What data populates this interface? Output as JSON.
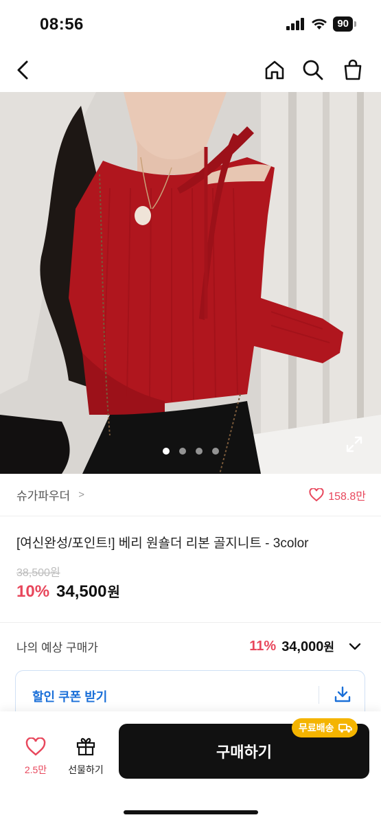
{
  "status_bar": {
    "time": "08:56",
    "battery": "90"
  },
  "nav": {
    "icons": [
      "back-chevron-icon",
      "home-icon",
      "search-icon",
      "shopping-bag-icon"
    ]
  },
  "hero": {
    "slides_total": 4,
    "active_slide": 1,
    "colors": {
      "sweater": "#b0161e",
      "background": "#d9d6d2"
    }
  },
  "brand": {
    "name": "슈가파우더",
    "chevron": ">",
    "likes": "158.8만"
  },
  "product": {
    "title": "[여신완성/포인트!] 베리 원숄더 리본 골지니트 - 3color",
    "original_price": "38,500원",
    "discount": "10%",
    "price": "34,500",
    "currency": "원"
  },
  "expected": {
    "label": "나의 예상 구매가",
    "discount": "11%",
    "price": "34,000",
    "currency": "원"
  },
  "coupon": {
    "label": "할인 쿠폰 받기"
  },
  "bottom": {
    "like_count": "2.5만",
    "gift_label": "선물하기",
    "buy_label": "구매하기",
    "shipping_badge": "무료배송"
  },
  "colors": {
    "accent": "#e8475c",
    "link_blue": "#1a6fd8",
    "badge": "#f4b400"
  }
}
